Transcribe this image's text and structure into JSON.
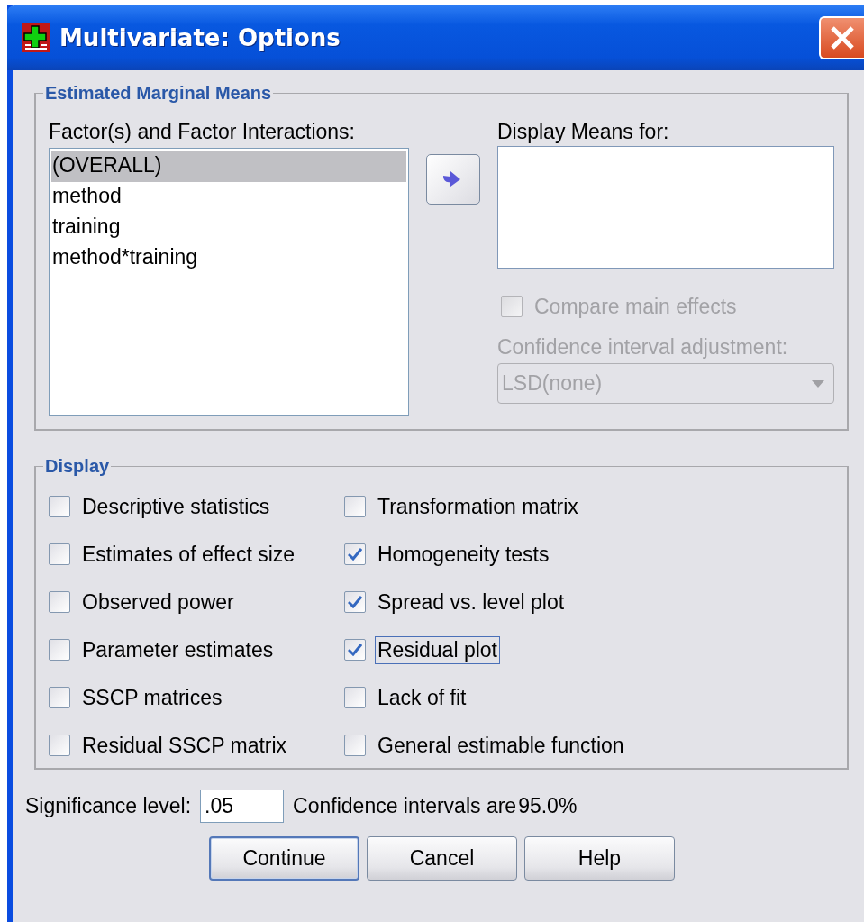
{
  "window": {
    "title": "Multivariate: Options"
  },
  "estimated_marginal_means": {
    "title": "Estimated Marginal Means",
    "factors_label": "Factor(s) and Factor Interactions:",
    "factors": [
      {
        "label": "(OVERALL)",
        "selected": true
      },
      {
        "label": "method",
        "selected": false
      },
      {
        "label": "training",
        "selected": false
      },
      {
        "label": "method*training",
        "selected": false
      }
    ],
    "display_means_label": "Display Means for:",
    "compare_main_effects": {
      "label": "Compare main effects",
      "checked": false,
      "disabled": true
    },
    "adjustment_label": "Confidence interval adjustment:",
    "adjustment": {
      "value": "LSD(none)",
      "disabled": true
    }
  },
  "display": {
    "title": "Display",
    "options": [
      {
        "label": "Descriptive statistics",
        "checked": false,
        "focused": false
      },
      {
        "label": "Transformation matrix",
        "checked": false,
        "focused": false
      },
      {
        "label": "Estimates of effect size",
        "checked": false,
        "focused": false
      },
      {
        "label": "Homogeneity tests",
        "checked": true,
        "focused": false
      },
      {
        "label": "Observed power",
        "checked": false,
        "focused": false
      },
      {
        "label": "Spread vs. level plot",
        "checked": true,
        "focused": false
      },
      {
        "label": "Parameter estimates",
        "checked": false,
        "focused": false
      },
      {
        "label": "Residual plot",
        "checked": true,
        "focused": true
      },
      {
        "label": "SSCP matrices",
        "checked": false,
        "focused": false
      },
      {
        "label": "Lack of fit",
        "checked": false,
        "focused": false
      },
      {
        "label": "Residual SSCP matrix",
        "checked": false,
        "focused": false
      },
      {
        "label": "General estimable function",
        "checked": false,
        "focused": false
      }
    ]
  },
  "significance": {
    "label": "Significance level:",
    "value": ".05",
    "note": "Confidence intervals are",
    "percent": "95.0%"
  },
  "buttons": [
    {
      "label": "Continue",
      "default": true
    },
    {
      "label": "Cancel",
      "default": false
    },
    {
      "label": "Help",
      "default": false
    }
  ]
}
